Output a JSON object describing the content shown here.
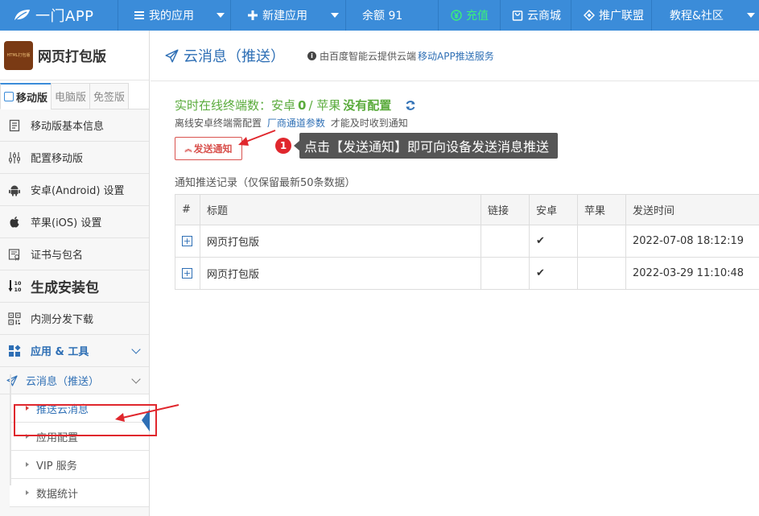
{
  "brand": {
    "name": "一门APP"
  },
  "topnav": {
    "my_apps": "我的应用",
    "new_app": "新建应用",
    "balance": "余额 91",
    "recharge": "充值",
    "cloud_store": "云商城",
    "affiliate": "推广联盟",
    "tutorials": "教程&社区"
  },
  "app": {
    "icon_text": "HTML打包版",
    "name": "网页打包版"
  },
  "version_tabs": [
    "移动版",
    "电脑版",
    "免签版"
  ],
  "sidebar": {
    "basic_info": "移动版基本信息",
    "config": "配置移动版",
    "android": "安卓(Android) 设置",
    "ios": "苹果(iOS) 设置",
    "cert": "证书与包名",
    "build": "生成安装包",
    "beta": "内测分发下载",
    "tools": "应用 & 工具",
    "cloud_msg": "云消息（推送）",
    "sub_items": [
      "推送云消息",
      "应用配置",
      "VIP 服务",
      "数据统计"
    ]
  },
  "page": {
    "title": "云消息（推送）",
    "note": "由百度智能云提供云端",
    "note_link": "移动APP推送服务",
    "online_prefix": "实时在线终端数：安卓",
    "online_android": "0",
    "online_sep": "/ 苹果",
    "online_ios": "没有配置",
    "offline_pre": "离线安卓终端需配置",
    "offline_link": "厂商通道参数",
    "offline_post": "才能及时收到通知",
    "send_button": "发送通知",
    "hint_number": "1",
    "hint_text": "点击【发送通知】即可向设备发送消息推送",
    "records_title": "通知推送记录（仅保留最新50条数据）"
  },
  "table": {
    "headers": [
      "#",
      "标题",
      "链接",
      "安卓",
      "苹果",
      "发送时间"
    ],
    "rows": [
      {
        "title": "网页打包版",
        "link": "",
        "android": "✔",
        "ios": "",
        "time": "2022-07-08 18:12:19"
      },
      {
        "title": "网页打包版",
        "link": "",
        "android": "✔",
        "ios": "",
        "time": "2022-03-29 11:10:48"
      }
    ]
  },
  "colors": {
    "nav": "#3b8cd9",
    "accent": "#2e6fb5",
    "online_green": "#5aab3c",
    "annotation_red": "#e0272d"
  }
}
